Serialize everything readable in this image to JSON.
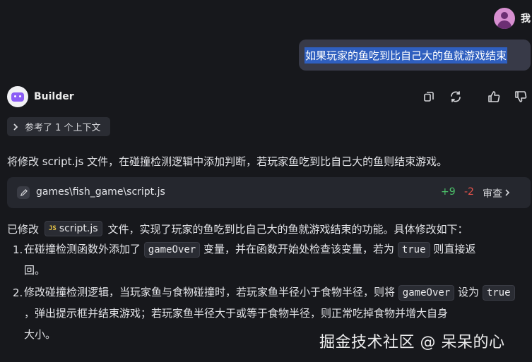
{
  "user": {
    "name": "我",
    "message": "如果玩家的鱼吃到比自己大的鱼就游戏结束"
  },
  "bot": {
    "name": "Builder"
  },
  "actions": [
    "copy-icon",
    "refresh-icon",
    "thumbs-up-icon",
    "thumbs-down-icon"
  ],
  "context_chip": {
    "label": "参考了 1 个上下文"
  },
  "intro": "将修改 script.js 文件，在碰撞检测逻辑中添加判断，若玩家鱼吃到比自己大的鱼则结束游戏。",
  "file_card": {
    "path": "games\\fish_game\\script.js",
    "additions": "+9",
    "deletions": "-2",
    "review_label": "审查"
  },
  "summary": {
    "prefix": "已修改",
    "file_badge": "JS",
    "file": "script.js",
    "suffix": "文件，实现了玩家的鱼吃到比自己大的鱼就游戏结束的功能。具体修改如下："
  },
  "items": [
    {
      "num": "1.",
      "p1": "在碰撞检测函数外添加了",
      "c1": "gameOver",
      "p2": "变量，并在函数开始处检查该变量，若为",
      "c2": "true",
      "p3": "则直接返",
      "p4": "回。"
    },
    {
      "num": "2.",
      "p1": "修改碰撞检测逻辑，当玩家鱼与食物碰撞时，若玩家鱼半径小于食物半径，则将",
      "c1": "gameOver",
      "p2": "设为",
      "c2": "true",
      "p3": "，弹出提示框并结束游戏；若玩家鱼半径大于或等于食物半径，则正常吃掉食物并增大自身",
      "p4": "大小。"
    }
  ],
  "watermark": "掘金技术社区 @ 呆呆的心",
  "colors": {
    "background": "#17181c",
    "bubble": "#383a48",
    "selection": "#2f5fbf",
    "add": "#4cc36a",
    "del": "#e5534b",
    "bot_accent": "#8b5cf6"
  }
}
